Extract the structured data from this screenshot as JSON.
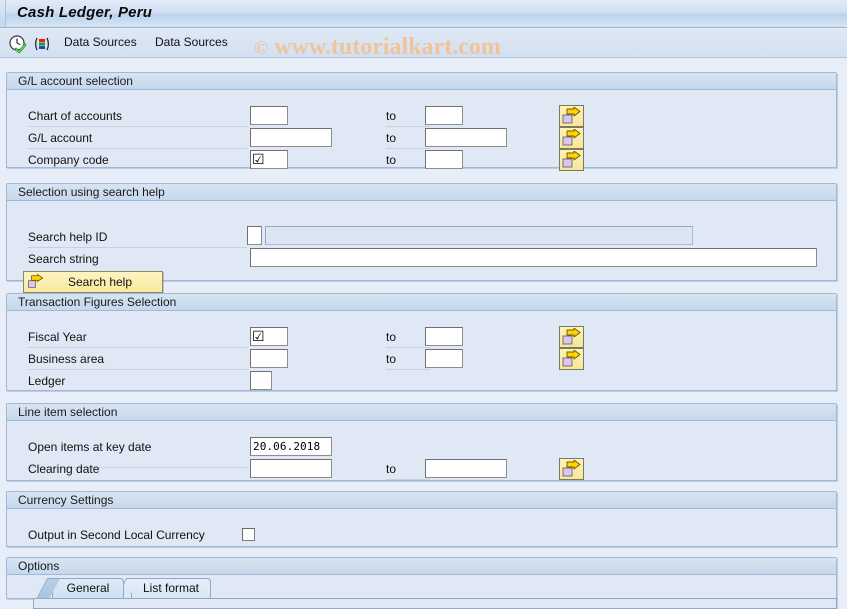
{
  "window": {
    "title": "Cash Ledger, Peru"
  },
  "toolbar": {
    "icons": [
      {
        "name": "execute-clock-check-icon",
        "title": "Execute"
      },
      {
        "name": "variant-bars-icon",
        "title": "Get Variant"
      }
    ],
    "menus": [
      {
        "label": "Data Sources"
      },
      {
        "label": "Data Sources"
      }
    ],
    "watermark": {
      "copyright": "©",
      "text": "www.tutorialkart.com",
      "color": "#f0c49a"
    }
  },
  "groups": {
    "gl_account_selection": {
      "title": "G/L account selection",
      "rows": [
        {
          "label": "Chart of accounts",
          "from_value": "",
          "from_width": 38,
          "has_checkbox_glyph": false,
          "to_label": "to",
          "to_value": "",
          "to_width": 38,
          "has_arrow": true
        },
        {
          "label": "G/L account",
          "from_value": "",
          "from_width": 82,
          "has_checkbox_glyph": false,
          "to_label": "to",
          "to_value": "",
          "to_width": 82,
          "has_arrow": true
        },
        {
          "label": "Company code",
          "from_value": "",
          "from_width": 38,
          "has_checkbox_glyph": true,
          "to_label": "to",
          "to_value": "",
          "to_width": 38,
          "has_arrow": true
        }
      ]
    },
    "search_help_selection": {
      "title": "Selection using search help",
      "search_help_id": {
        "label": "Search help ID",
        "value": "",
        "long_value": "",
        "long_disabled": true
      },
      "search_string": {
        "label": "Search string",
        "value": ""
      },
      "search_help_button": {
        "label": "Search help",
        "icon": "arrow-right-folder-icon"
      }
    },
    "transaction_figures_selection": {
      "title": "Transaction Figures Selection",
      "rows": [
        {
          "label": "Fiscal Year",
          "from_value": "",
          "from_width": 38,
          "has_checkbox_glyph": true,
          "to_label": "to",
          "to_value": "",
          "to_width": 38,
          "has_arrow": true
        },
        {
          "label": "Business area",
          "from_value": "",
          "from_width": 38,
          "has_checkbox_glyph": false,
          "to_label": "to",
          "to_value": "",
          "to_width": 38,
          "has_arrow": true
        },
        {
          "label": "Ledger",
          "from_value": "",
          "from_width": 22,
          "has_checkbox_glyph": false,
          "to_label": "",
          "to_value": null,
          "to_width": 0,
          "has_arrow": false
        }
      ]
    },
    "line_item_selection": {
      "title": "Line item selection",
      "rows": [
        {
          "label": "Open items at key date",
          "from_value": "20.06.2018",
          "from_width": 82,
          "mono": true,
          "to_label": "",
          "to_value": null,
          "to_width": 0,
          "has_arrow": false
        },
        {
          "label": "Clearing date",
          "from_value": "",
          "from_width": 82,
          "mono": false,
          "to_label": "to",
          "to_value": "",
          "to_width": 82,
          "has_arrow": true
        }
      ]
    },
    "currency_settings": {
      "title": "Currency Settings",
      "checkbox_label": "Output in Second Local Currency",
      "checked": false
    },
    "options": {
      "title": "Options",
      "tabs": [
        {
          "label": "General",
          "selected": true
        },
        {
          "label": "List format",
          "selected": false
        }
      ]
    }
  }
}
